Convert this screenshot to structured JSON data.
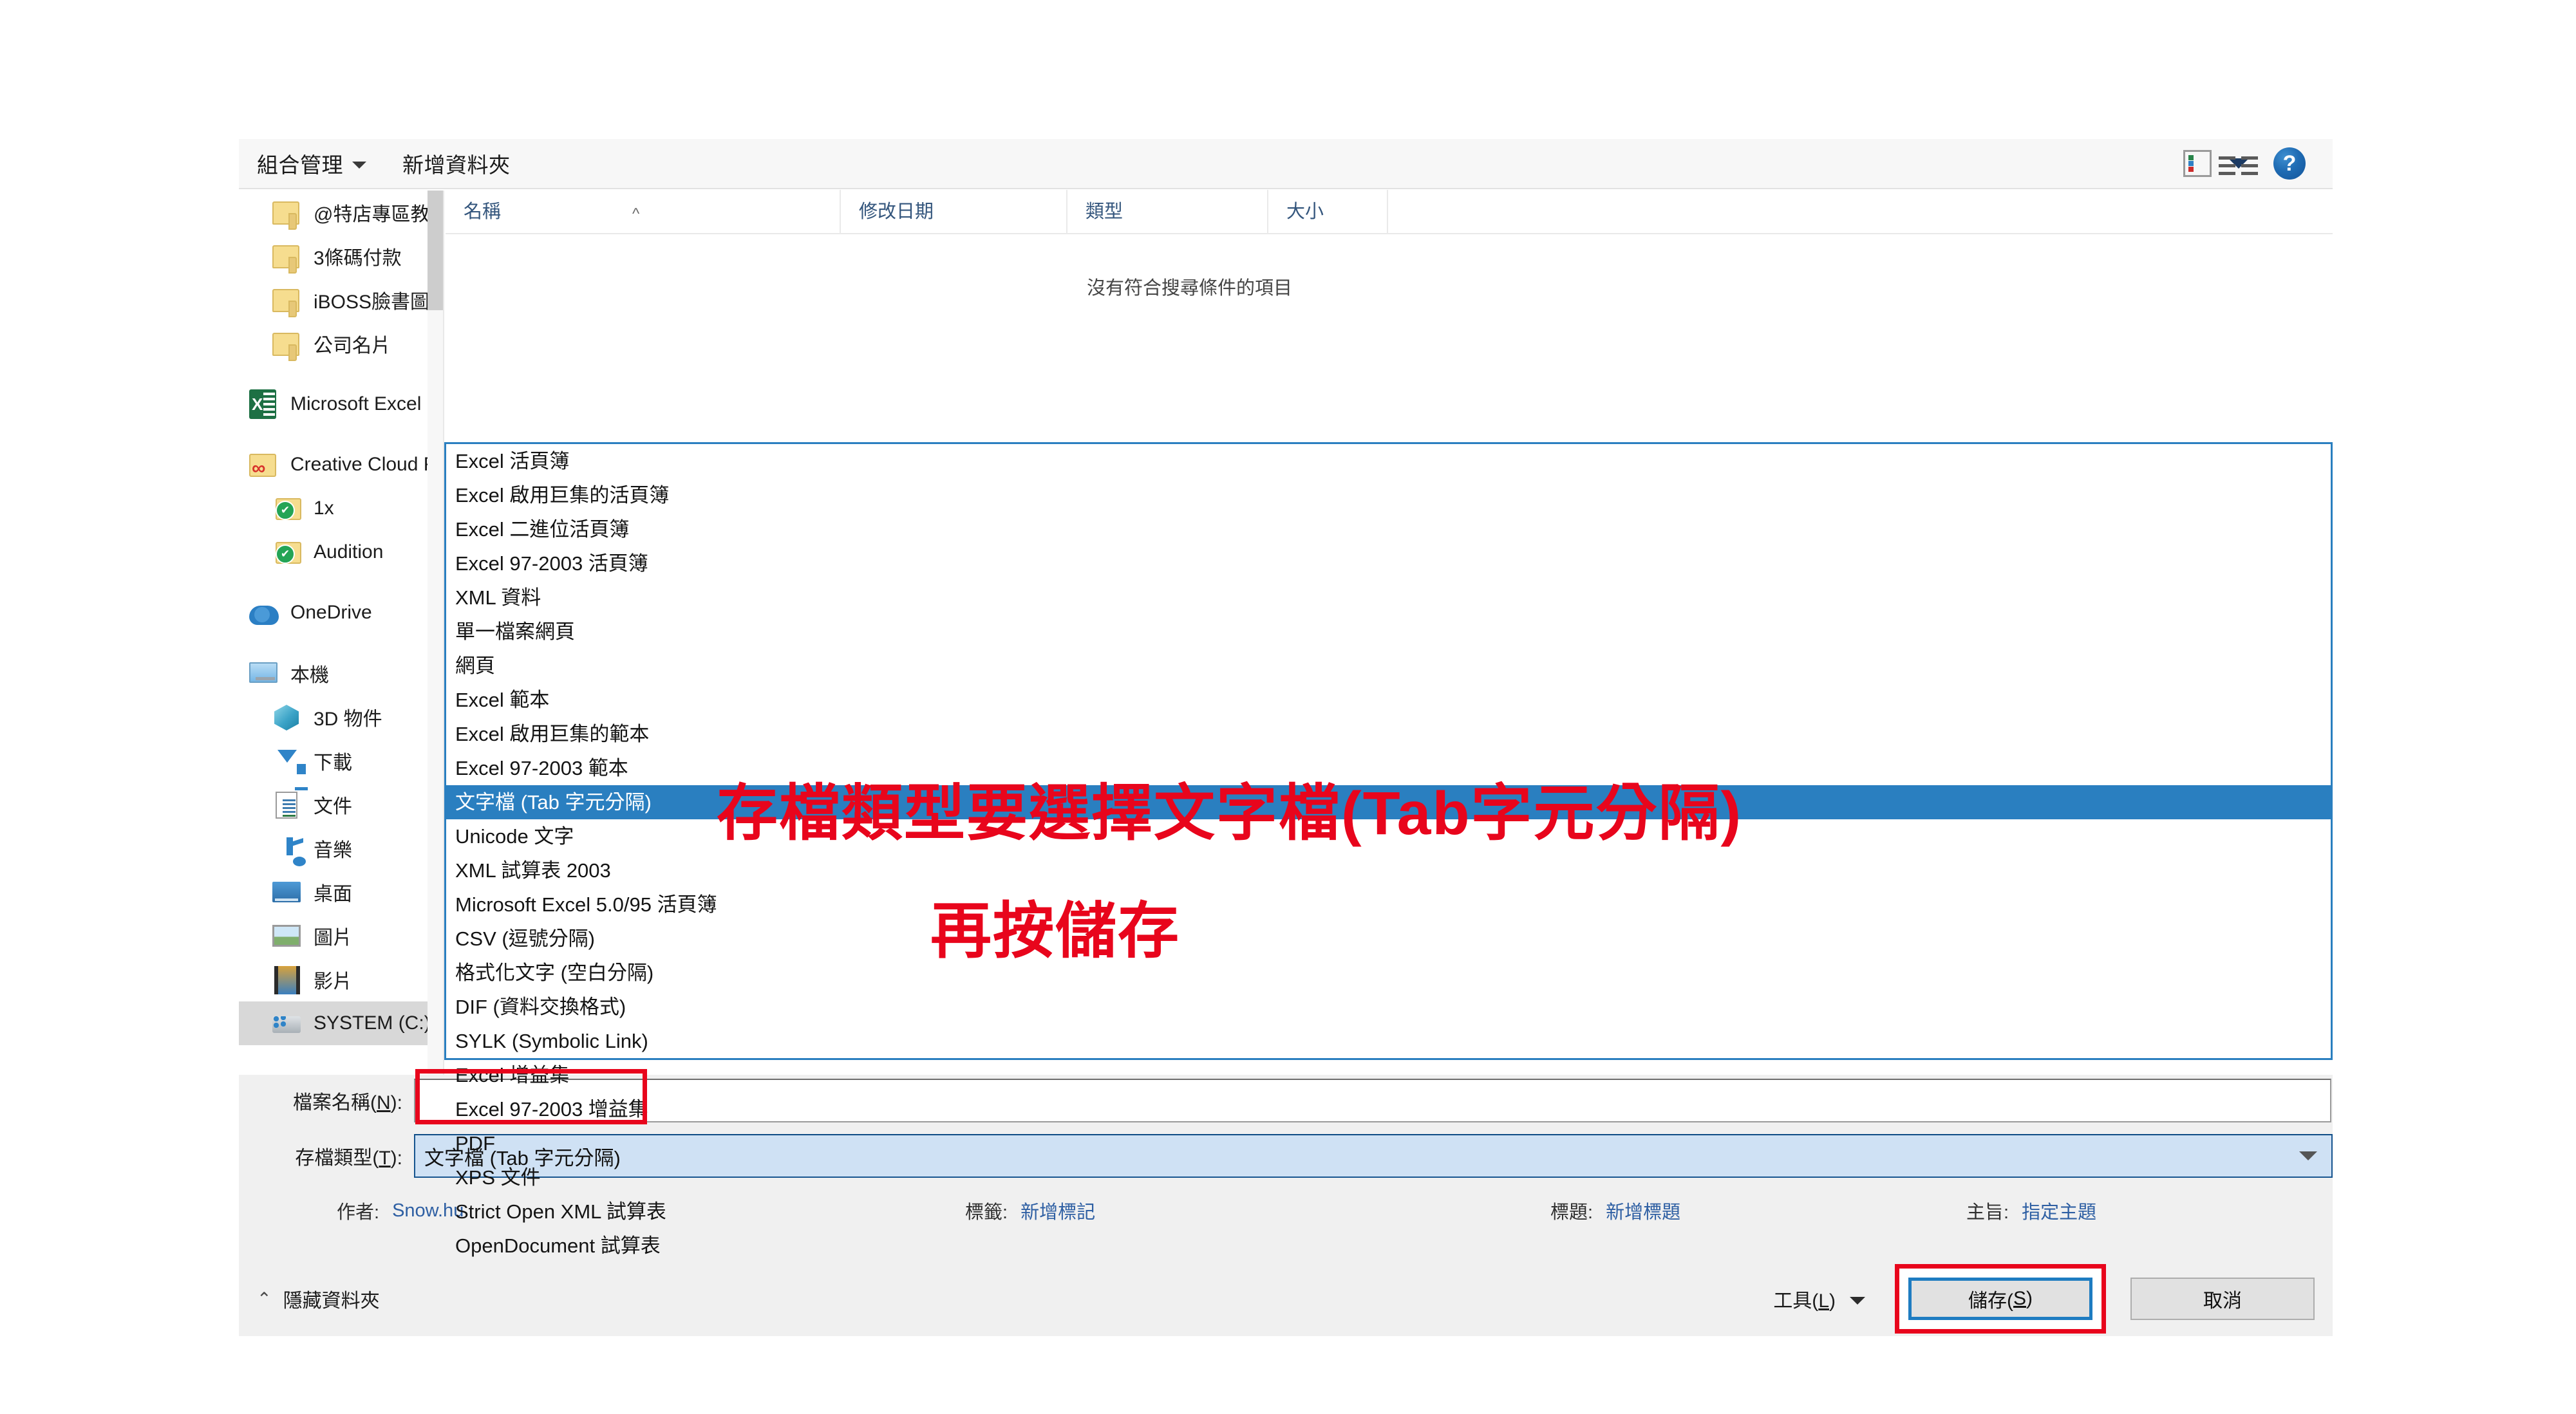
{
  "toolbar": {
    "organize_label": "組合管理",
    "new_folder_label": "新增資料夾",
    "view_icon": "list-view-icon",
    "help_icon": "help-icon",
    "help_glyph": "?"
  },
  "nav_pane": {
    "items": [
      {
        "label": "@特店專區教學:",
        "icon": "folder-icon",
        "level": 1,
        "selected": false
      },
      {
        "label": "3條碼付款",
        "icon": "folder-icon",
        "level": 1,
        "selected": false
      },
      {
        "label": "iBOSS臉書圖文",
        "icon": "folder-icon",
        "level": 1,
        "selected": false
      },
      {
        "label": "公司名片",
        "icon": "folder-icon",
        "level": 1,
        "selected": false
      },
      {
        "label": "Microsoft Excel",
        "icon": "excel-icon",
        "level": 0,
        "selected": false
      },
      {
        "label": "Creative Cloud Files",
        "icon": "creative-cloud-folder-icon",
        "level": 0,
        "selected": false
      },
      {
        "label": "1x",
        "icon": "synced-folder-icon",
        "level": 1,
        "selected": false
      },
      {
        "label": "Audition",
        "icon": "synced-folder-icon",
        "level": 1,
        "selected": false
      },
      {
        "label": "OneDrive",
        "icon": "onedrive-cloud-icon",
        "level": 0,
        "selected": false
      },
      {
        "label": "本機",
        "icon": "this-pc-icon",
        "level": 0,
        "selected": false
      },
      {
        "label": "3D 物件",
        "icon": "3d-objects-icon",
        "level": 1,
        "selected": false
      },
      {
        "label": "下載",
        "icon": "downloads-icon",
        "level": 1,
        "selected": false
      },
      {
        "label": "文件",
        "icon": "documents-icon",
        "level": 1,
        "selected": false
      },
      {
        "label": "音樂",
        "icon": "music-icon",
        "level": 1,
        "selected": false
      },
      {
        "label": "桌面",
        "icon": "desktop-icon",
        "level": 1,
        "selected": false
      },
      {
        "label": "圖片",
        "icon": "pictures-icon",
        "level": 1,
        "selected": false
      },
      {
        "label": "影片",
        "icon": "videos-icon",
        "level": 1,
        "selected": false
      },
      {
        "label": "SYSTEM (C:)",
        "icon": "drive-icon",
        "level": 1,
        "selected": true
      }
    ]
  },
  "file_list": {
    "columns": [
      "名稱",
      "修改日期",
      "類型",
      "大小"
    ],
    "sort_indicator": "^",
    "empty_message": "沒有符合搜尋條件的項目",
    "rows": []
  },
  "file_type_dropdown": {
    "open": true,
    "selected_value": "文字檔 (Tab 字元分隔)",
    "options": [
      "Excel 活頁簿",
      "Excel 啟用巨集的活頁簿",
      "Excel 二進位活頁簿",
      "Excel 97-2003 活頁簿",
      "XML 資料",
      "單一檔案網頁",
      "網頁",
      "Excel 範本",
      "Excel 啟用巨集的範本",
      "Excel 97-2003 範本",
      "文字檔 (Tab 字元分隔)",
      "Unicode 文字",
      "XML 試算表 2003",
      "Microsoft Excel 5.0/95 活頁簿",
      "CSV (逗號分隔)",
      "格式化文字 (空白分隔)",
      "DIF (資料交換格式)",
      "SYLK (Symbolic Link)",
      "Excel 增益集",
      "Excel 97-2003 增益集",
      "PDF",
      "XPS 文件",
      "Strict Open XML 試算表",
      "OpenDocument 試算表"
    ]
  },
  "form": {
    "file_name_label": "檔案名稱(N):",
    "file_name_label_pre": "檔案名稱(",
    "file_name_label_key": "N",
    "file_name_label_post": "):",
    "file_name_value": "",
    "file_type_label_pre": "存檔類型(",
    "file_type_label_key": "T",
    "file_type_label_post": "):",
    "file_type_value": "文字檔 (Tab 字元分隔)",
    "metadata": [
      {
        "key": "作者:",
        "value": "Snow.hu"
      },
      {
        "key": "標籤:",
        "value": "新增標記"
      },
      {
        "key": "標題:",
        "value": "新增標題"
      },
      {
        "key": "主旨:",
        "value": "指定主題"
      }
    ]
  },
  "footer": {
    "hide_folders_label": "隱藏資料夾",
    "hide_folders_chevron": "⌃",
    "tools_label_pre": "工具(",
    "tools_label_key": "L",
    "tools_label_post": ")",
    "save_label_pre": "儲存(",
    "save_label_key": "S",
    "save_label_post": ")",
    "cancel_label": "取消"
  },
  "annotations": {
    "line1": "存檔類型要選擇文字檔(Tab字元分隔)",
    "line2": "再按儲存",
    "color": "#e8051c"
  }
}
